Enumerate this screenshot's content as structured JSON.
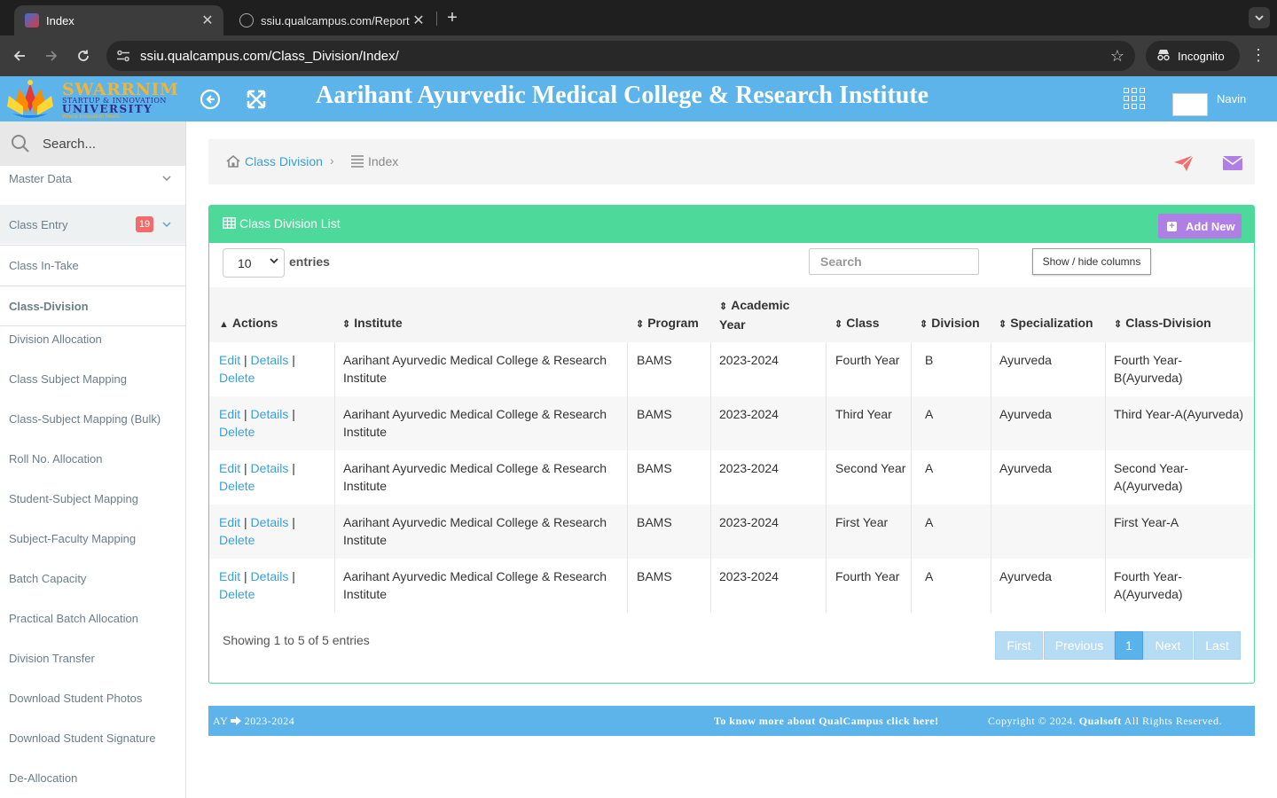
{
  "browser": {
    "tabs": [
      {
        "title": "Index",
        "close": "✕"
      },
      {
        "title": "ssiu.qualcampus.com/Report",
        "close": "✕"
      }
    ],
    "new_tab": "+",
    "url": "ssiu.qualcampus.com/Class_Division/Index/",
    "incognito_label": "Incognito"
  },
  "header": {
    "logo_line1": "SWARRNIM",
    "logo_line2": "STARTUP & INNOVATION",
    "logo_line3": "UNIVERSITY",
    "logo_line4": "Where Innovation Meets",
    "title": "Aarihant Ayurvedic Medical College & Research Institute",
    "user_name": "Navin",
    "colors": {
      "header_bg": "#5db4ea",
      "panel_green": "#4cd999",
      "add_new_purple": "#b07fe6",
      "link_blue": "#3aa0d8",
      "badge_red": "#f26b6b"
    }
  },
  "sidebar": {
    "search_placeholder": "Search...",
    "items": [
      {
        "label": "Master Data"
      },
      {
        "label": "Class Entry",
        "badge": "19"
      },
      {
        "label": "Class In-Take"
      },
      {
        "label": "Class-Division"
      },
      {
        "label": "Division Allocation"
      },
      {
        "label": "Class Subject Mapping"
      },
      {
        "label": "Class-Subject Mapping (Bulk)"
      },
      {
        "label": "Roll No. Allocation"
      },
      {
        "label": "Student-Subject Mapping"
      },
      {
        "label": "Subject-Faculty Mapping"
      },
      {
        "label": "Batch Capacity"
      },
      {
        "label": "Practical Batch Allocation"
      },
      {
        "label": "Division Transfer"
      },
      {
        "label": "Download Student Photos"
      },
      {
        "label": "Download Student Signature"
      },
      {
        "label": "De-Allocation"
      }
    ]
  },
  "breadcrumb": {
    "link": "Class Division",
    "separator": "›",
    "current": "Index"
  },
  "panel": {
    "title": "Class Division List",
    "add_new": "Add New",
    "entries_value": "10",
    "entries_label": "entries",
    "search_placeholder": "Search",
    "show_hide": "Show / hide columns",
    "columns": [
      "Actions",
      "Institute",
      "Program",
      "Academic Year",
      "Class",
      "Division",
      "Specialization",
      "Class-Division"
    ],
    "action_labels": {
      "edit": "Edit",
      "details": "Details",
      "delete": "Delete",
      "sep": "|"
    },
    "rows": [
      {
        "institute": "Aarihant Ayurvedic Medical College & Research Institute",
        "program": "BAMS",
        "year": "2023-2024",
        "class": "Fourth Year",
        "division": "B",
        "specialization": "Ayurveda",
        "class_division": "Fourth Year-B(Ayurveda)"
      },
      {
        "institute": "Aarihant Ayurvedic Medical College & Research Institute",
        "program": "BAMS",
        "year": "2023-2024",
        "class": "Third Year",
        "division": "A",
        "specialization": "Ayurveda",
        "class_division": "Third Year-A(Ayurveda)"
      },
      {
        "institute": "Aarihant Ayurvedic Medical College & Research Institute",
        "program": "BAMS",
        "year": "2023-2024",
        "class": "Second Year",
        "division": "A",
        "specialization": "Ayurveda",
        "class_division": "Second Year-A(Ayurveda)"
      },
      {
        "institute": "Aarihant Ayurvedic Medical College & Research Institute",
        "program": "BAMS",
        "year": "2023-2024",
        "class": "First Year",
        "division": "A",
        "specialization": "",
        "class_division": "First Year-A"
      },
      {
        "institute": "Aarihant Ayurvedic Medical College & Research Institute",
        "program": "BAMS",
        "year": "2023-2024",
        "class": "Fourth Year",
        "division": "A",
        "specialization": "Ayurveda",
        "class_division": "Fourth Year-A(Ayurveda)"
      }
    ],
    "showing": "Showing 1 to 5 of 5 entries",
    "pager": {
      "first": "First",
      "previous": "Previous",
      "current": "1",
      "next": "Next",
      "last": "Last"
    }
  },
  "footer": {
    "ay_label": "AY",
    "ay_value": "2023-2024",
    "more": "To know more about QualCampus click here!",
    "copyright": "Copyright © 2024.",
    "company": "Qualsoft",
    "rights": "All Rights Reserved."
  }
}
